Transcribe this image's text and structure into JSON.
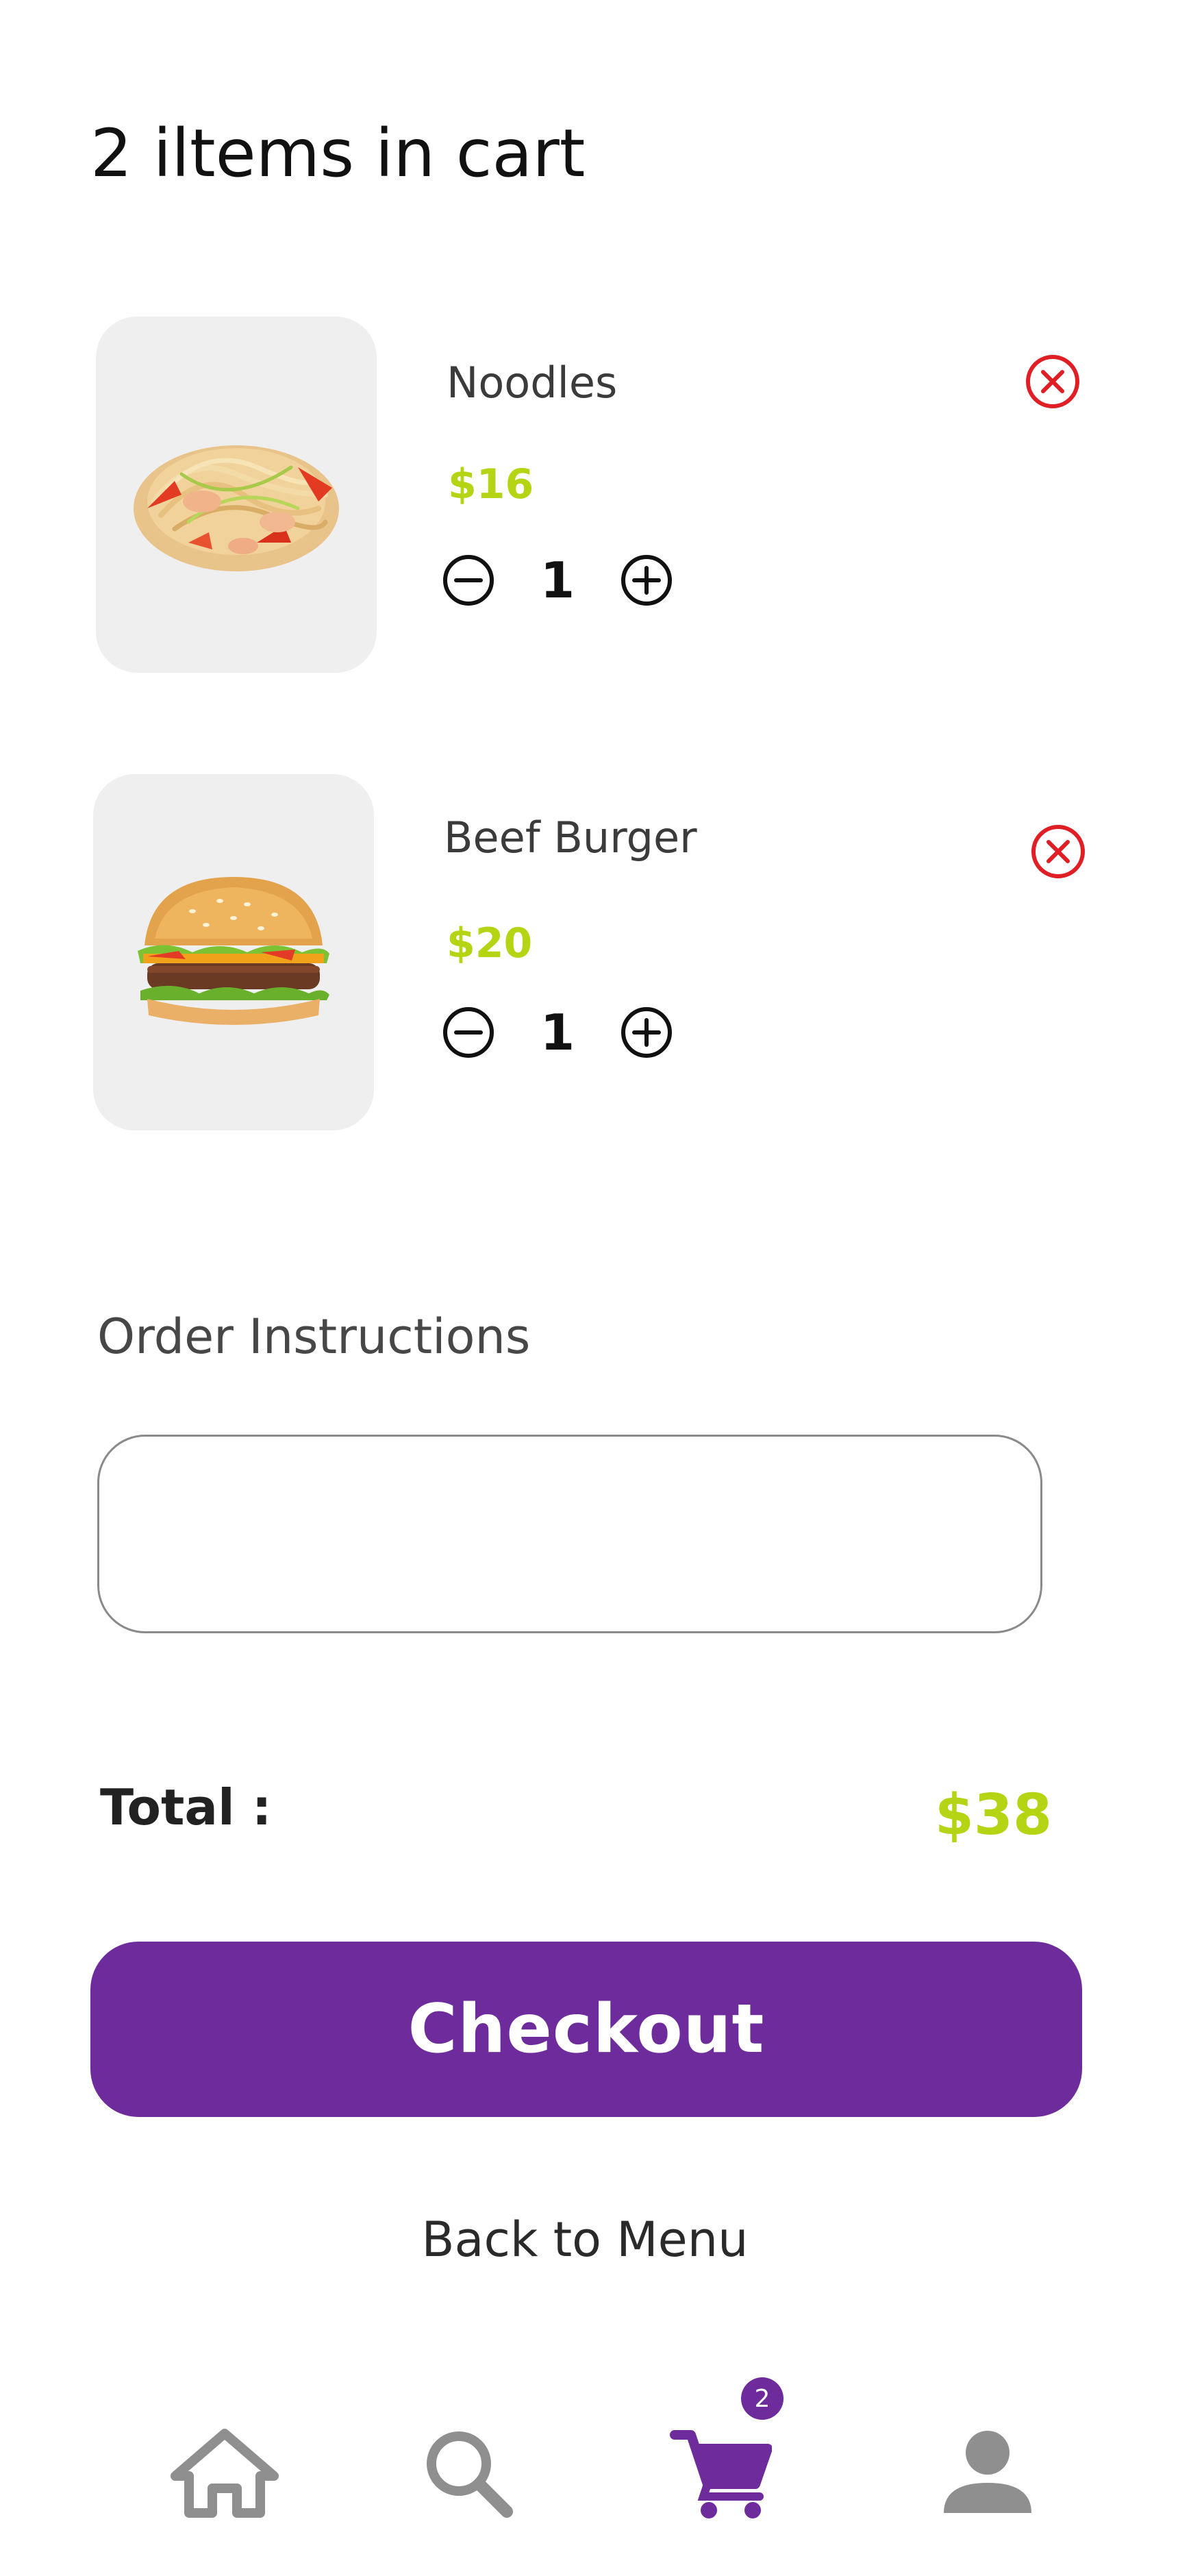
{
  "header": {
    "title": "2 iltems in cart"
  },
  "cart": {
    "items": [
      {
        "name": "Noodles",
        "price": "$16",
        "quantity": "1",
        "image_icon": "noodles-image"
      },
      {
        "name": "Beef Burger",
        "price": "$20",
        "quantity": "1",
        "image_icon": "burger-image"
      }
    ]
  },
  "instructions": {
    "label": "Order Instructions",
    "value": ""
  },
  "summary": {
    "total_label": "Total :",
    "total_value": "$38"
  },
  "actions": {
    "checkout_label": "Checkout",
    "back_label": "Back to Menu"
  },
  "nav": {
    "items": [
      {
        "icon": "home-icon",
        "active": false
      },
      {
        "icon": "search-icon",
        "active": false
      },
      {
        "icon": "cart-icon",
        "active": true
      },
      {
        "icon": "profile-icon",
        "active": false
      }
    ],
    "cart_badge": "2"
  },
  "colors": {
    "accent": "#6e2b9c",
    "price": "#b5d414",
    "remove": "#e01e26",
    "inactive_icon": "#8f8f8f"
  }
}
